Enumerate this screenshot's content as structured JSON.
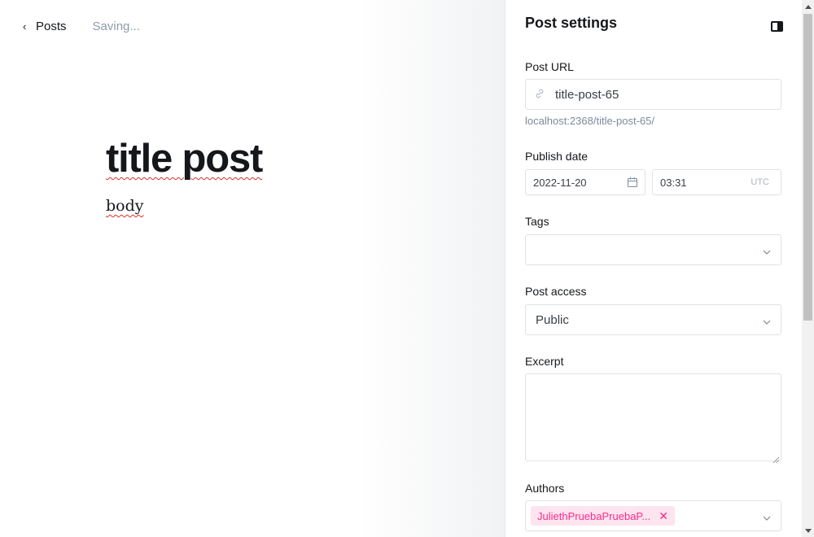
{
  "editor": {
    "back_label": "Posts",
    "status": "Saving...",
    "title": "title post",
    "body": "body"
  },
  "settings": {
    "title": "Post settings",
    "toggle_icon": "sidebar-toggle-icon",
    "post_url": {
      "label": "Post URL",
      "value": "title-post-65",
      "hint": "localhost:2368/title-post-65/"
    },
    "publish_date": {
      "label": "Publish date",
      "date": "2022-11-20",
      "time": "03:31",
      "timezone": "UTC"
    },
    "tags": {
      "label": "Tags",
      "value": ""
    },
    "post_access": {
      "label": "Post access",
      "value": "Public"
    },
    "excerpt": {
      "label": "Excerpt",
      "value": ""
    },
    "authors": {
      "label": "Authors",
      "chips": [
        "JuliethPruebaPruebaP..."
      ]
    }
  },
  "colors": {
    "accent_pink": "#fb2d8d",
    "chip_bg": "#fde4ef",
    "muted_text": "#8e9cac",
    "spellcheck": "#d9302b"
  }
}
